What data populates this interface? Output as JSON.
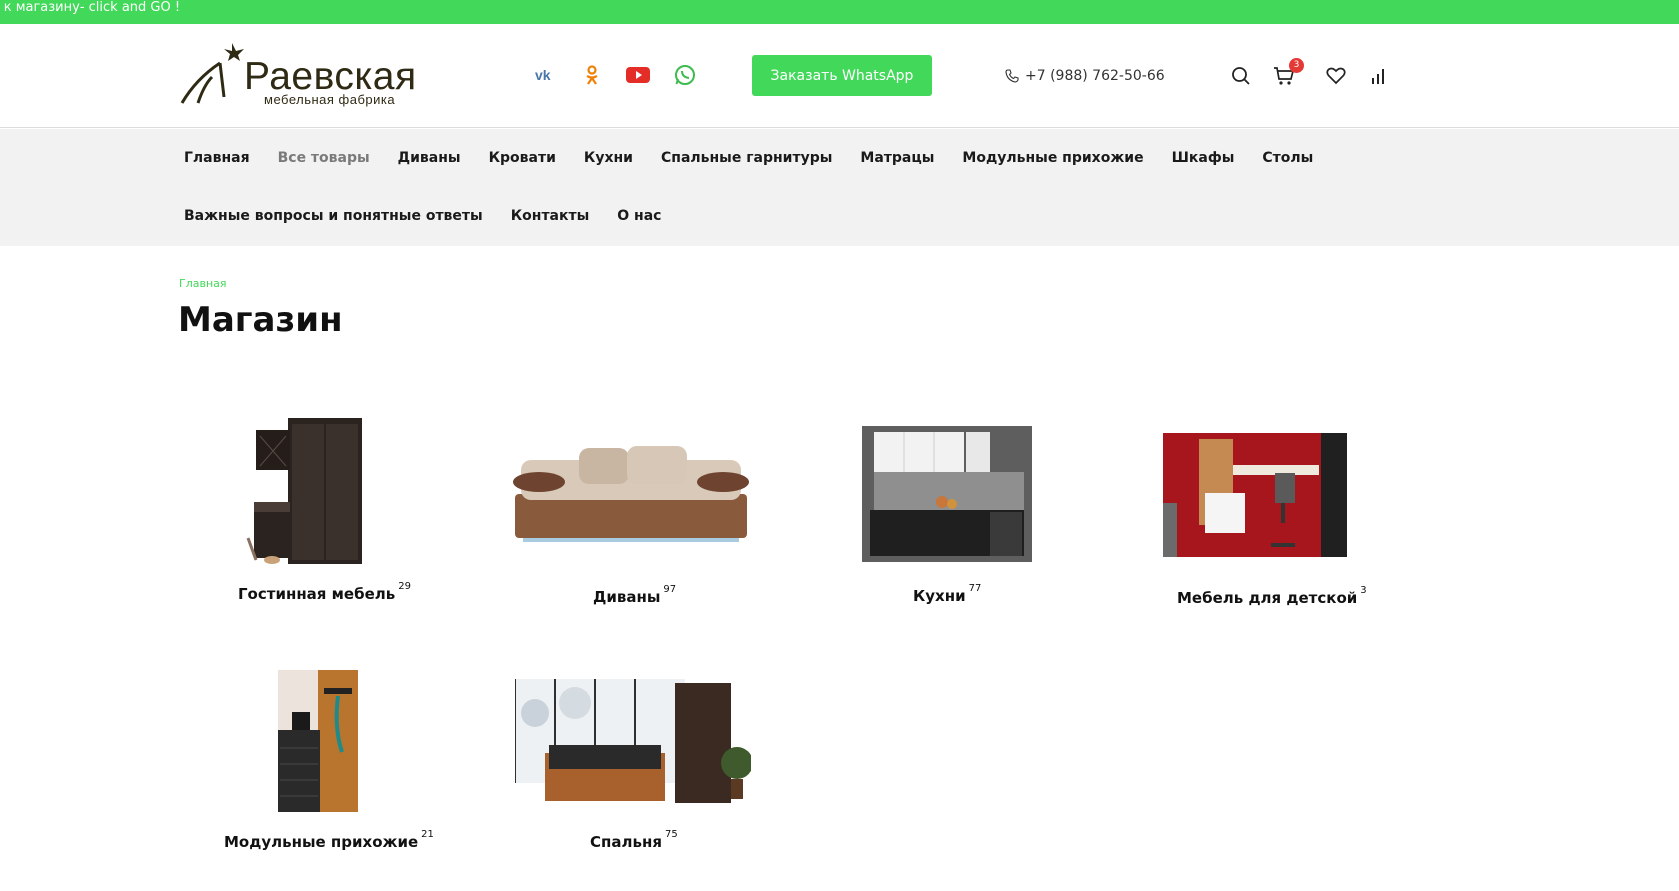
{
  "announcement": "т к магазину- click and GO !",
  "brand": {
    "name": "Раевская",
    "tagline": "мебельная фабрика",
    "accent": "#42d95a"
  },
  "header": {
    "social": [
      {
        "name": "vk-icon",
        "color": "#4a76a8"
      },
      {
        "name": "odnoklassniki-icon",
        "color": "#ee8208"
      },
      {
        "name": "youtube-icon",
        "color": "#e52d27"
      },
      {
        "name": "whatsapp-icon",
        "color": "#3dbb4f"
      }
    ],
    "whatsapp_button": "Заказать WhatsApp",
    "phone": "+7 (988) 762-50-66",
    "cart_count": "3"
  },
  "nav": {
    "row1": [
      "Главная",
      "Все товары",
      "Диваны",
      "Кровати",
      "Кухни",
      "Спальные гарнитуры",
      "Матрацы",
      "Модульные прихожие",
      "Шкафы",
      "Столы"
    ],
    "row2": [
      "Важные вопросы и понятные ответы",
      "Контакты",
      "О нас"
    ]
  },
  "breadcrumb": "Главная",
  "page_title": "Магазин",
  "categories": [
    {
      "name": "Гостинная мебель",
      "count": "29"
    },
    {
      "name": "Диваны",
      "count": "97"
    },
    {
      "name": "Кухни",
      "count": "77"
    },
    {
      "name": "Мебель для детской",
      "count": "3"
    },
    {
      "name": "Модульные прихожие",
      "count": "21"
    },
    {
      "name": "Спальня",
      "count": "75"
    }
  ]
}
